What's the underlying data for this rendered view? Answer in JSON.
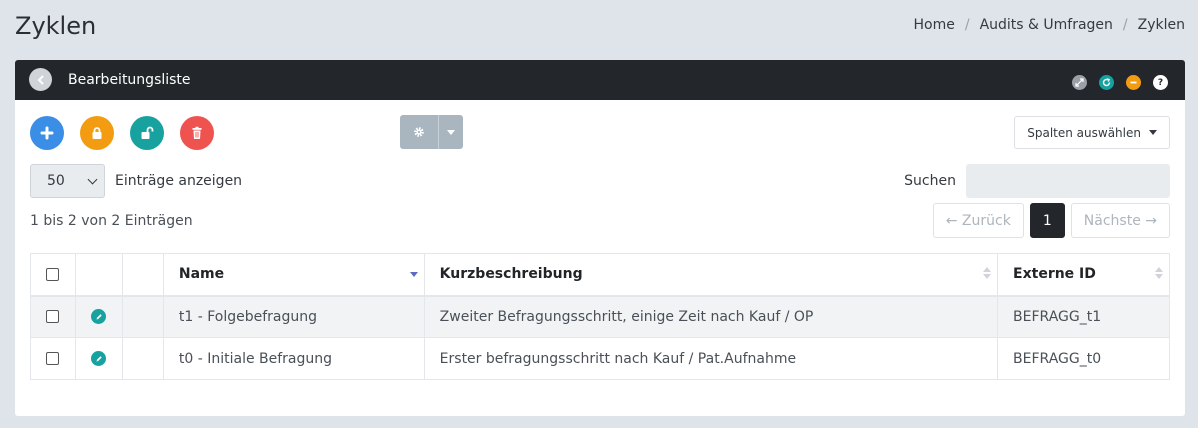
{
  "page": {
    "title": "Zyklen"
  },
  "breadcrumb": {
    "items": [
      "Home",
      "Audits & Umfragen",
      "Zyklen"
    ],
    "separator": "/"
  },
  "panel": {
    "title": "Bearbeitungsliste"
  },
  "toolbar": {
    "columns_label": "Spalten auswählen"
  },
  "length": {
    "value": "50",
    "label": "Einträge anzeigen"
  },
  "search": {
    "label": "Suchen",
    "value": ""
  },
  "info": "1 bis 2 von 2 Einträgen",
  "pagination": {
    "prev": "← Zurück",
    "current": "1",
    "next": "Nächste →"
  },
  "table": {
    "headers": [
      "Name",
      "Kurzbeschreibung",
      "Externe ID"
    ],
    "rows": [
      {
        "name": "t1 - Folgebefragung",
        "description": "Zweiter Befragungsschritt, einige Zeit nach Kauf / OP",
        "external_id": "BEFRAGG_t1"
      },
      {
        "name": "t0 - Initiale Befragung",
        "description": "Erster befragungsschritt nach Kauf / Pat.Aufnahme",
        "external_id": "BEFRAGG_t0"
      }
    ]
  },
  "colors": {
    "header_bg": "#23272b",
    "add": "#3a8ee6",
    "lock": "#f39c12",
    "unlock": "#17a2a0",
    "delete": "#ef5350",
    "teal": "#17a2a0"
  }
}
